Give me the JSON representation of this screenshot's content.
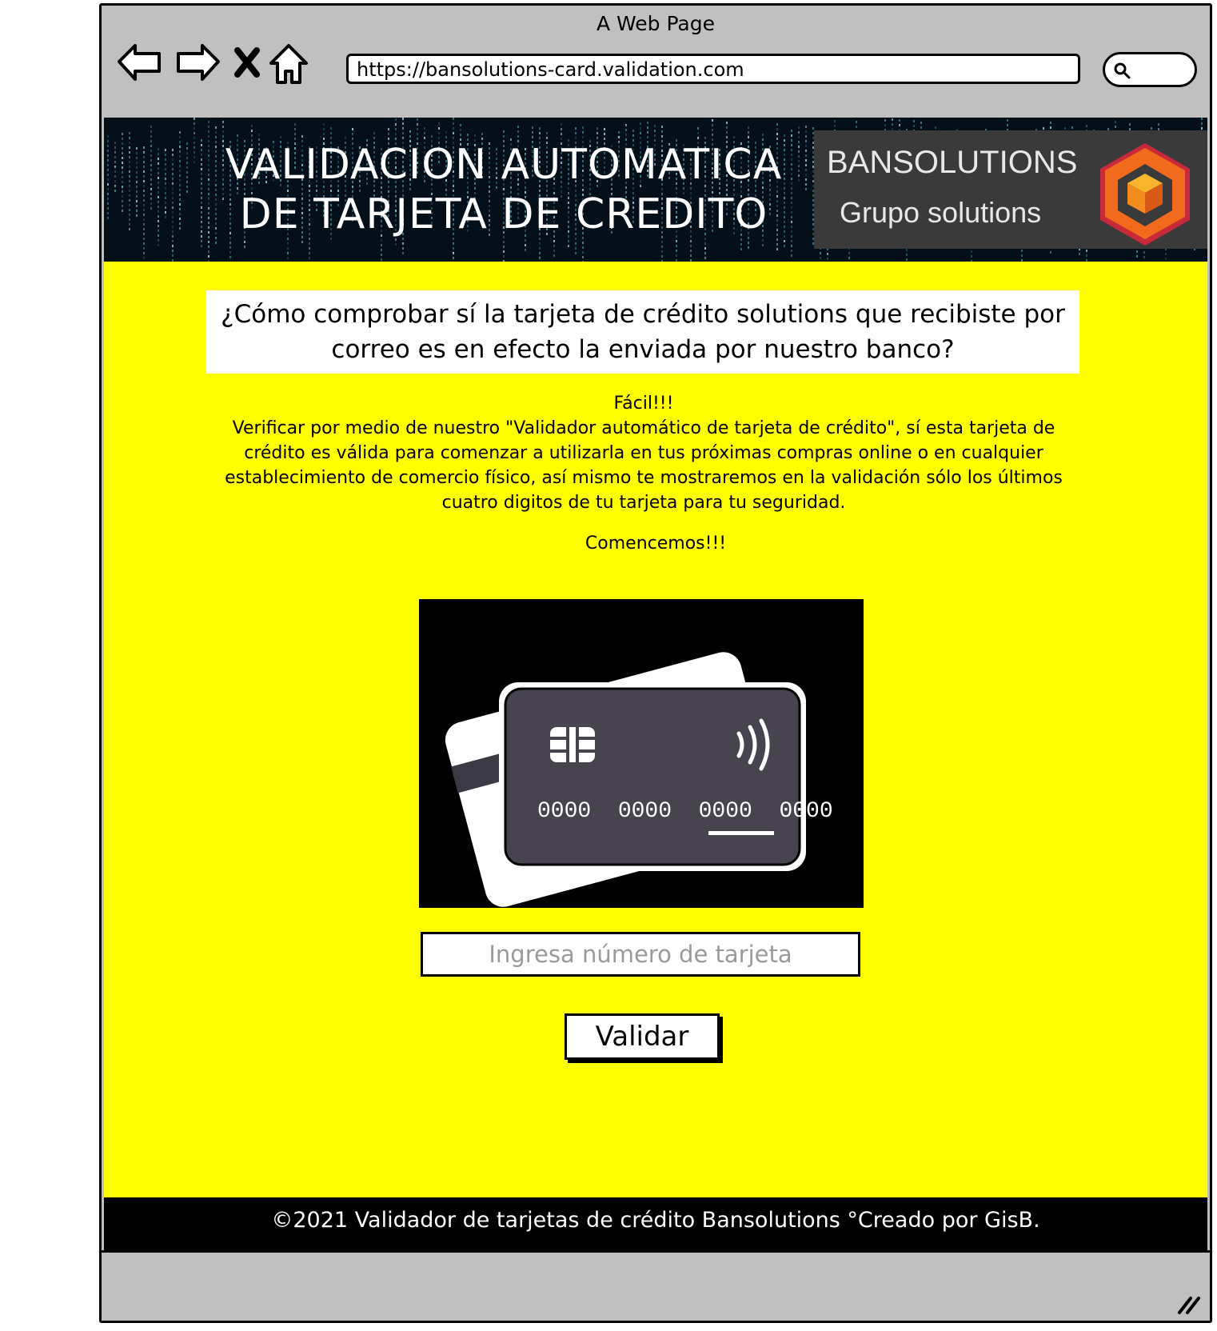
{
  "window": {
    "title": "A Web Page",
    "url": "https://bansolutions-card.validation.com"
  },
  "header": {
    "title_line1": "VALIDACION AUTOMATICA",
    "title_line2": "DE TARJETA DE CREDITO",
    "logo_name": "BANSOLUTIONS",
    "logo_subtitle": "Grupo solutions"
  },
  "main": {
    "question": "¿Cómo comprobar sí la tarjeta de crédito solutions que recibiste por correo es en efecto la enviada por nuestro banco?",
    "easy": "Fácil!!!",
    "description": "Verificar por medio de nuestro \"Validador automático de tarjeta de crédito\", sí esta tarjeta de crédito es válida para comenzar a utilizarla en tus próximas compras online o en cualquier establecimiento de comercio físico, así mismo te mostraremos en la validación sólo los últimos cuatro digitos de tu tarjeta para tu seguridad.",
    "start": "Comencemos!!!",
    "card_number_display": "0000  0000  0000  0000",
    "card_input_placeholder": "Ingresa número de tarjeta",
    "validate_label": "Validar"
  },
  "footer": {
    "text": "©2021 Validador de tarjetas de crédito Bansolutions °Creado por GisB."
  },
  "colors": {
    "page_background": "#ffff00",
    "footer_background": "#000000",
    "banner_background": "#03101a",
    "logo_orange": "#f26b1d",
    "logo_red": "#c92a3a"
  },
  "icons": [
    "back-arrow-icon",
    "forward-arrow-icon",
    "close-icon",
    "home-icon",
    "search-icon",
    "resize-grip-icon"
  ]
}
